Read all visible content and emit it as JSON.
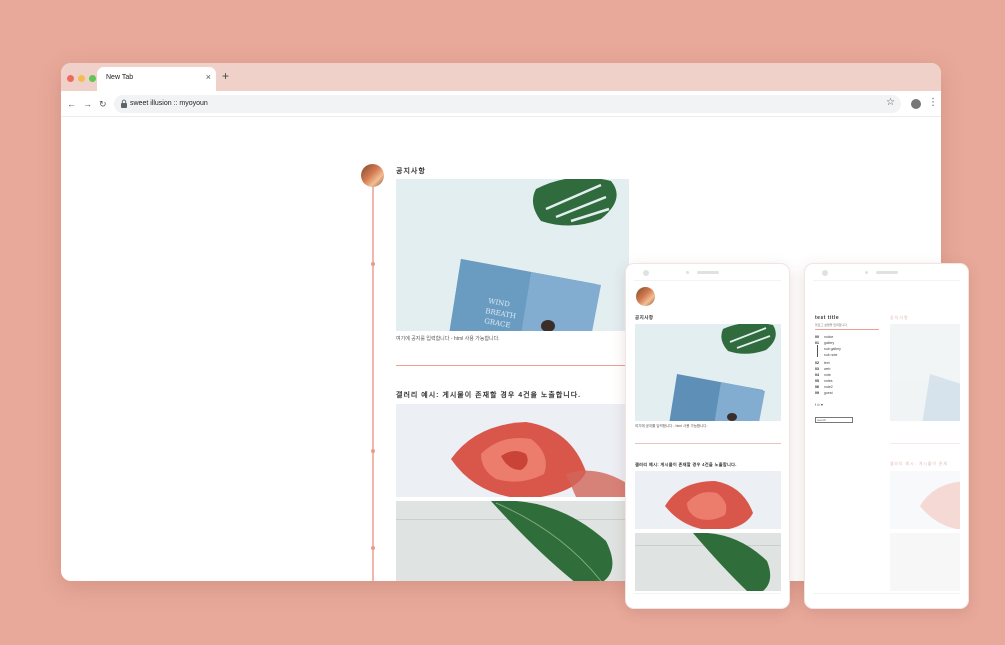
{
  "browser": {
    "tab_title": "New Tab",
    "tab_close": "×",
    "new_tab": "+",
    "back": "←",
    "forward": "→",
    "reload": "↻",
    "url": "sweet illusion :: myoyoun",
    "star": "☆",
    "menu": "⋮",
    "traffic_colors": [
      "#ee6a5f",
      "#f5bd4f",
      "#61c454"
    ]
  },
  "post1": {
    "title": "공지사항",
    "text": "여기에 공지를 입력합니다 - html 사용 가능합니다."
  },
  "post2": {
    "title": "갤러리 예시: 게시물이 존재할 경우 4건을 노출합니다."
  },
  "phone1": {
    "title": "공지사항",
    "text": "여기에 공지를 입력합니다 - html 사용 가능합니다.",
    "title2": "갤러리 예시: 게시물이 존재할 경우 4건을 노출합니다."
  },
  "phone2": {
    "title": "test title",
    "subtitle": "블로그 설명을 입력합니다.",
    "menu": [
      {
        "num": "00",
        "label": "notice"
      },
      {
        "num": "01",
        "label": "gallery"
      },
      {
        "num": "",
        "label": "sub gallery"
      },
      {
        "num": "",
        "label": "sub note"
      },
      {
        "num": "02",
        "label": "text"
      },
      {
        "num": "03",
        "label": "web"
      },
      {
        "num": "04",
        "label": "note"
      },
      {
        "num": "05",
        "label": "notes"
      },
      {
        "num": "06",
        "label": "note2"
      },
      {
        "num": "09",
        "label": "guest"
      }
    ],
    "social": "f  ⊙  ♥",
    "search": "search",
    "faded_title": "공지사항",
    "faded_title2": "갤러리 예시: 게시물이 존재"
  }
}
